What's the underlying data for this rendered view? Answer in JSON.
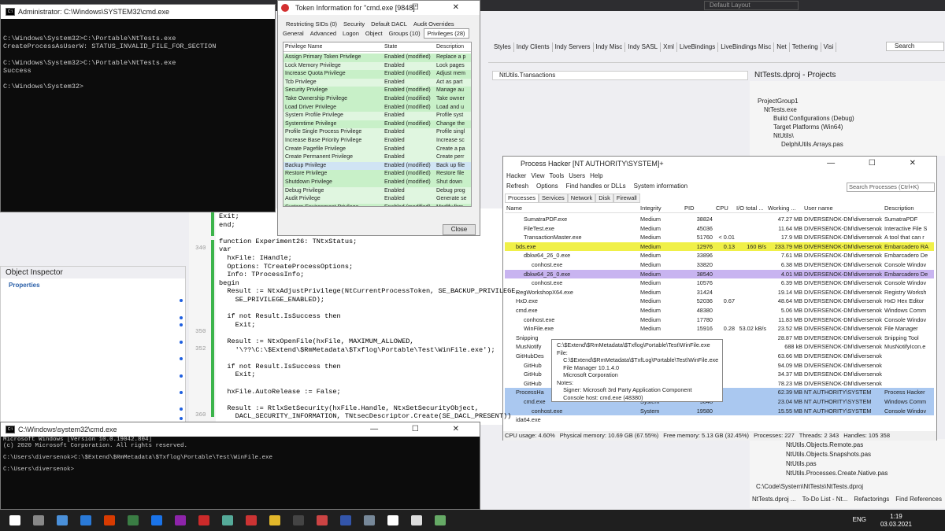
{
  "ide": {
    "layout": "Default Layout",
    "toolbar": [
      "Styles",
      "Indy Clients",
      "Indy Servers",
      "Indy Misc",
      "Indy SASL",
      "Xml",
      "LiveBindings",
      "LiveBindings Misc",
      "Net",
      "Tethering",
      "Visi"
    ],
    "search": "Search",
    "tab": "NtUtils.Transactions"
  },
  "admin_cmd": {
    "title": "Administrator: C:\\Windows\\SYSTEM32\\cmd.exe",
    "lines": [
      "C:\\Windows\\System32>C:\\Portable\\NtTests.exe",
      "CreateProcessAsUserW: STATUS_INVALID_FILE_FOR_SECTION",
      "",
      "C:\\Windows\\System32>C:\\Portable\\NtTests.exe",
      "Success",
      "",
      "C:\\Windows\\System32>"
    ]
  },
  "small_cmd": {
    "title": "C:\\Windows\\system32\\cmd.exe",
    "lines": [
      "Microsoft Windows [Version 10.0.19042.804]",
      "(c) 2020 Microsoft Corporation. All rights reserved.",
      "",
      "C:\\Users\\diversenok>C:\\$Extend\\$RmMetadata\\$Txflog\\Portable\\Test\\WinFile.exe",
      "",
      "C:\\Users\\diversenok>"
    ]
  },
  "object_inspector": {
    "title": "Object Inspector",
    "tab": "Properties"
  },
  "code": [
    {
      "n": "",
      "t": "Exit;"
    },
    {
      "n": "",
      "t": "end;"
    },
    {
      "n": "",
      "t": ""
    },
    {
      "n": "",
      "t": "function Experiment26: TNtxStatus;"
    },
    {
      "n": "340",
      "t": "var"
    },
    {
      "n": "",
      "t": "  hxFile: IHandle;"
    },
    {
      "n": "",
      "t": "  Options: TCreateProcessOptions;"
    },
    {
      "n": "",
      "t": "  Info: TProcessInfo;"
    },
    {
      "n": "",
      "t": "begin"
    },
    {
      "n": "",
      "t": "  Result := NtxAdjustPrivilege(NtCurrentProcessToken, SE_BACKUP_PRIVILEGE,"
    },
    {
      "n": "",
      "t": "    SE_PRIVILEGE_ENABLED);"
    },
    {
      "n": "",
      "t": ""
    },
    {
      "n": "",
      "t": "  if not Result.IsSuccess then"
    },
    {
      "n": "",
      "t": "    Exit;"
    },
    {
      "n": "350",
      "t": ""
    },
    {
      "n": "",
      "t": "  Result := NtxOpenFile(hxFile, MAXIMUM_ALLOWED,"
    },
    {
      "n": "352",
      "t": "    '\\??\\C:\\$Extend\\$RmMetadata\\$Txflog\\Portable\\Test\\WinFile.exe');"
    },
    {
      "n": "",
      "t": ""
    },
    {
      "n": "",
      "t": "  if not Result.IsSuccess then"
    },
    {
      "n": "",
      "t": "    Exit;"
    },
    {
      "n": "",
      "t": ""
    },
    {
      "n": "",
      "t": "  hxFile.AutoRelease := False;"
    },
    {
      "n": "",
      "t": ""
    },
    {
      "n": "",
      "t": "  Result := RtlxSetSecurity(hxFile.Handle, NtxSetSecurityObject,"
    },
    {
      "n": "360",
      "t": "    DACL_SECURITY_INFORMATION, TNtsecDescriptor.Create(SE_DACL_PRESENT))"
    }
  ],
  "projects": {
    "title": "NtTests.dproj - Projects",
    "items": [
      "ProjectGroup1",
      "NtTests.exe",
      "Build Configurations (Debug)",
      "Target Platforms (Win64)",
      "NtUtils\\",
      "DelphiUtils.Arrays.pas"
    ],
    "items2": [
      "NtUtils.Objects.Remote.pas",
      "NtUtils.Objects.Snapshots.pas",
      "NtUtils.pas",
      "NtUtils.Processes.Create.Native.pas"
    ],
    "path": "C:\\Code\\System\\NtTests\\NtTests.dproj",
    "tabs": [
      "NtTests.dproj ...",
      "To-Do List - Nt...",
      "Refactorings",
      "Find References"
    ]
  },
  "token": {
    "title": "Token Information for \"cmd.exe [9848]\"",
    "tabs1": [
      "Restricting SIDs (0)",
      "Security",
      "Default DACL",
      "Audit Overrides"
    ],
    "tabs2": [
      "General",
      "Advanced",
      "Logon",
      "Object",
      "Groups (10)",
      "Privileges (28)"
    ],
    "cols": [
      "Privilege Name",
      "State",
      "Description"
    ],
    "rows": [
      [
        "Assign Primary Token Privilege",
        "Enabled (modified)",
        "Replace a p",
        "g"
      ],
      [
        "Lock Memory Privilege",
        "Enabled",
        "Lock pages",
        "w"
      ],
      [
        "Increase Quota Privilege",
        "Enabled (modified)",
        "Adjust mem",
        "g"
      ],
      [
        "Tcb Privilege",
        "Enabled",
        "Act as part",
        "w"
      ],
      [
        "Security Privilege",
        "Enabled (modified)",
        "Manage au",
        "g"
      ],
      [
        "Take Ownership Privilege",
        "Enabled (modified)",
        "Take owner",
        "g"
      ],
      [
        "Load Driver Privilege",
        "Enabled (modified)",
        "Load and u",
        "g"
      ],
      [
        "System Profile Privilege",
        "Enabled",
        "Profile syst",
        "w"
      ],
      [
        "Systemtime Privilege",
        "Enabled (modified)",
        "Change the",
        "g"
      ],
      [
        "Profile Single Process Privilege",
        "Enabled",
        "Profile singl",
        "w"
      ],
      [
        "Increase Base Priority Privilege",
        "Enabled",
        "Increase sc",
        "w"
      ],
      [
        "Create Pagefile Privilege",
        "Enabled",
        "Create a pa",
        "w"
      ],
      [
        "Create Permanent Privilege",
        "Enabled",
        "Create perr",
        "w"
      ],
      [
        "Backup Privilege",
        "Enabled (modified)",
        "Back up file",
        "b"
      ],
      [
        "Restore Privilege",
        "Enabled (modified)",
        "Restore file",
        "g"
      ],
      [
        "Shutdown Privilege",
        "Enabled (modified)",
        "Shut down",
        "g"
      ],
      [
        "Debug Privilege",
        "Enabled",
        "Debug prog",
        "w"
      ],
      [
        "Audit Privilege",
        "Enabled",
        "Generate se",
        "w"
      ],
      [
        "System Environment Privilege",
        "Enabled (modified)",
        "Modify firm",
        "g"
      ]
    ],
    "close": "Close"
  },
  "ph": {
    "title": "Process Hacker [NT AUTHORITY\\SYSTEM]+",
    "menu": [
      "Hacker",
      "View",
      "Tools",
      "Users",
      "Help"
    ],
    "toolbar": [
      "Refresh",
      "Options",
      "Find handles or DLLs",
      "System information"
    ],
    "search": "Search Processes (Ctrl+K)",
    "tabs": [
      "Processes",
      "Services",
      "Network",
      "Disk",
      "Firewall"
    ],
    "cols": [
      "Name",
      "Integrity",
      "PID",
      "CPU",
      "I/O total ...",
      "Working ...",
      "User name",
      "Description"
    ],
    "rows": [
      [
        "SumatraPDF.exe",
        "Medium",
        "38824",
        "",
        "",
        "47.27 MB",
        "DIVERSENOK-DM\\diversenok",
        "SumatraPDF",
        "",
        1
      ],
      [
        "FileTest.exe",
        "Medium",
        "45036",
        "",
        "",
        "11.64 MB",
        "DIVERSENOK-DM\\diversenok",
        "Interactive File S",
        "",
        1
      ],
      [
        "TransactionMaster.exe",
        "Medium",
        "51760",
        "< 0.01",
        "",
        "17.9 MB",
        "DIVERSENOK-DM\\diversenok",
        "A tool that can r",
        "",
        1
      ],
      [
        "bds.exe",
        "Medium",
        "12976",
        "0.13",
        "160 B/s",
        "233.79 MB",
        "DIVERSENOK-DM\\diversenok",
        "Embarcadero RA",
        "y",
        0
      ],
      [
        "dbkw64_26_0.exe",
        "Medium",
        "33896",
        "",
        "",
        "7.61 MB",
        "DIVERSENOK-DM\\diversenok",
        "Embarcadero De",
        "",
        1
      ],
      [
        "conhost.exe",
        "Medium",
        "33820",
        "",
        "",
        "6.38 MB",
        "DIVERSENOK-DM\\diversenok",
        "Console Windov",
        "",
        2
      ],
      [
        "dbkw64_26_0.exe",
        "Medium",
        "38540",
        "",
        "",
        "4.01 MB",
        "DIVERSENOK-DM\\diversenok",
        "Embarcadero De",
        "p",
        1
      ],
      [
        "conhost.exe",
        "Medium",
        "10576",
        "",
        "",
        "6.39 MB",
        "DIVERSENOK-DM\\diversenok",
        "Console Windov",
        "",
        2
      ],
      [
        "RegWorkshopX64.exe",
        "Medium",
        "31424",
        "",
        "",
        "19.14 MB",
        "DIVERSENOK-DM\\diversenok",
        "Registry Worksh",
        "",
        0
      ],
      [
        "HxD.exe",
        "Medium",
        "52036",
        "0.67",
        "",
        "48.64 MB",
        "DIVERSENOK-DM\\diversenok",
        "HxD Hex Editor",
        "",
        0
      ],
      [
        "cmd.exe",
        "Medium",
        "48380",
        "",
        "",
        "5.06 MB",
        "DIVERSENOK-DM\\diversenok",
        "Windows Comm",
        "",
        0
      ],
      [
        "conhost.exe",
        "Medium",
        "17780",
        "",
        "",
        "11.83 MB",
        "DIVERSENOK-DM\\diversenok",
        "Console Windov",
        "",
        1
      ],
      [
        "WinFile.exe",
        "Medium",
        "15916",
        "0.28",
        "53.02 kB/s",
        "23.52 MB",
        "DIVERSENOK-DM\\diversenok",
        "File Manager",
        "",
        1
      ],
      [
        "Snipping",
        "",
        "",
        "",
        "",
        "28.87 MB",
        "DIVERSENOK-DM\\diversenok",
        "Snipping Tool",
        "",
        0
      ],
      [
        "MusNotify",
        "",
        "",
        "",
        "",
        "688 kB",
        "DIVERSENOK-DM\\diversenok",
        "MusNotifyIcon.e",
        "",
        0
      ],
      [
        "GitHubDes",
        "",
        "",
        "",
        "",
        "63.66 MB",
        "DIVERSENOK-DM\\diversenok",
        "",
        "",
        0
      ],
      [
        "GitHub",
        "",
        "",
        "",
        "",
        "94.09 MB",
        "DIVERSENOK-DM\\diversenok",
        "",
        "",
        1
      ],
      [
        "GitHub",
        "",
        "",
        "",
        "",
        "34.37 MB",
        "DIVERSENOK-DM\\diversenok",
        "",
        "",
        1
      ],
      [
        "GitHub",
        "",
        "",
        "",
        "",
        "78.23 MB",
        "DIVERSENOK-DM\\diversenok",
        "",
        "",
        1
      ],
      [
        "ProcessHa",
        "",
        "",
        "",
        "",
        "62.39 MB",
        "NT AUTHORITY\\SYSTEM",
        "Process Hacker",
        "s",
        0
      ],
      [
        "cmd.exe",
        "System",
        "9848",
        "",
        "",
        "23.04 MB",
        "NT AUTHORITY\\SYSTEM",
        "Windows Comm",
        "s",
        1
      ],
      [
        "conhost.exe",
        "System",
        "19580",
        "",
        "",
        "15.55 MB",
        "NT AUTHORITY\\SYSTEM",
        "Console Windov",
        "s",
        2
      ],
      [
        "ida64.exe",
        "",
        "",
        "",
        "",
        "",
        "",
        "",
        "",
        0
      ]
    ],
    "status": [
      "CPU usage: 4.60%",
      "Physical memory: 10.69 GB (67.55%)",
      "Free memory: 5.13 GB (32.45%)",
      "Processes: 227",
      "Threads: 2 343",
      "Handles: 105 358"
    ],
    "tooltip": [
      "C:\\$Extend\\$RmMetadata\\$Txflog\\Portable\\Test\\WinFile.exe",
      "File:",
      "    C:\\$Extend\\$RmMetadata\\$TxfLog\\Portable\\Test\\WinFile.exe",
      "    File Manager 10.1.4.0",
      "    Microsoft Corporation",
      "Notes:",
      "    Signer: Microsoft 3rd Party Application Component",
      "    Console host: cmd.exe (48380)"
    ]
  },
  "taskbar": {
    "time": "1:19",
    "date": "03.03.2021",
    "lang": "ENG"
  },
  "colors": {
    "enabled_mod": "#c8f0c8",
    "enabled": "#e0f6e0",
    "backup": "#d0e4f4",
    "bds": "#f0f048",
    "purple": "#c8b4f0",
    "system": "#aac8f0"
  }
}
